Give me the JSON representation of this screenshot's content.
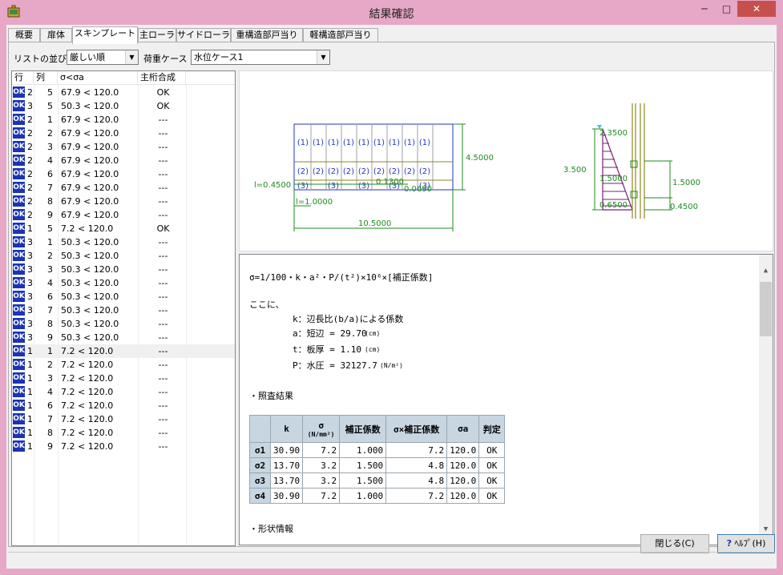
{
  "window": {
    "title": "結果確認",
    "min_glyph": "─",
    "max_glyph": "□",
    "close_glyph": "✕"
  },
  "tabs": [
    "概要",
    "扉体",
    "スキンプレート",
    "主ローラ",
    "サイドローラ",
    "重構造部戸当り",
    "軽構造部戸当り"
  ],
  "active_tab": 2,
  "filters": {
    "sort_label": "リストの並び",
    "sort_value": "厳しい順",
    "case_label": "荷重ケース",
    "case_value": "水位ケース1"
  },
  "list": {
    "headers": [
      "行",
      "列",
      "σ<σa",
      "主桁合成"
    ],
    "ok_badge": "OK",
    "rows": [
      [
        "2",
        "5",
        "67.9 < 120.0",
        "OK"
      ],
      [
        "3",
        "5",
        "50.3 < 120.0",
        "OK"
      ],
      [
        "2",
        "1",
        "67.9 < 120.0",
        "---"
      ],
      [
        "2",
        "2",
        "67.9 < 120.0",
        "---"
      ],
      [
        "2",
        "3",
        "67.9 < 120.0",
        "---"
      ],
      [
        "2",
        "4",
        "67.9 < 120.0",
        "---"
      ],
      [
        "2",
        "6",
        "67.9 < 120.0",
        "---"
      ],
      [
        "2",
        "7",
        "67.9 < 120.0",
        "---"
      ],
      [
        "2",
        "8",
        "67.9 < 120.0",
        "---"
      ],
      [
        "2",
        "9",
        "67.9 < 120.0",
        "---"
      ],
      [
        "1",
        "5",
        "7.2 < 120.0",
        "OK"
      ],
      [
        "3",
        "1",
        "50.3 < 120.0",
        "---"
      ],
      [
        "3",
        "2",
        "50.3 < 120.0",
        "---"
      ],
      [
        "3",
        "3",
        "50.3 < 120.0",
        "---"
      ],
      [
        "3",
        "4",
        "50.3 < 120.0",
        "---"
      ],
      [
        "3",
        "6",
        "50.3 < 120.0",
        "---"
      ],
      [
        "3",
        "7",
        "50.3 < 120.0",
        "---"
      ],
      [
        "3",
        "8",
        "50.3 < 120.0",
        "---"
      ],
      [
        "3",
        "9",
        "50.3 < 120.0",
        "---"
      ],
      [
        "1",
        "1",
        "7.2 < 120.0",
        "---"
      ],
      [
        "1",
        "2",
        "7.2 < 120.0",
        "---"
      ],
      [
        "1",
        "3",
        "7.2 < 120.0",
        "---"
      ],
      [
        "1",
        "4",
        "7.2 < 120.0",
        "---"
      ],
      [
        "1",
        "6",
        "7.2 < 120.0",
        "---"
      ],
      [
        "1",
        "7",
        "7.2 < 120.0",
        "---"
      ],
      [
        "1",
        "8",
        "7.2 < 120.0",
        "---"
      ],
      [
        "1",
        "9",
        "7.2 < 120.0",
        "---"
      ]
    ],
    "selected_index": 19
  },
  "diagram": {
    "panel_labels_1": "(1)",
    "panel_labels_2": "(2)",
    "panel_labels_3": "(3)",
    "dim_height": "4.5000",
    "dim_width": "10.5000",
    "dim_l045": "l=0.4500",
    "dim_l10": "l=1.0000",
    "dim_1300": "0.1300",
    "dim_0690": "0.0690",
    "side_2350": "2.3500",
    "side_3500": "3.500",
    "side_1500a": "1.5000",
    "side_1500b": "1.5000",
    "side_0650": "0.6500",
    "side_0450": "0.4500"
  },
  "report": {
    "formula": "σ=1/100・k・a²・P/(t²)×10⁶×[補正係数]",
    "where": "ここに、",
    "k_def": "k：辺長比(b/a)による係数",
    "a_def": "a：短辺 = 29.70",
    "a_unit": "(cm)",
    "t_def": "t：板厚 = 1.10",
    "t_unit": "(cm)",
    "p_def": "P：水圧 = 32127.7",
    "p_unit": "(N/m²)",
    "check_title": "・照査結果",
    "next_title": "・形状情報",
    "table_headers": [
      "",
      "k",
      "σ",
      "補正係数",
      "σ×補正係数",
      "σa",
      "判定"
    ],
    "sigma_unit": "(N/mm²)",
    "table_rows": [
      [
        "σ1",
        "30.90",
        "7.2",
        "1.000",
        "7.2",
        "120.0",
        "OK"
      ],
      [
        "σ2",
        "13.70",
        "3.2",
        "1.500",
        "4.8",
        "120.0",
        "OK"
      ],
      [
        "σ3",
        "13.70",
        "3.2",
        "1.500",
        "4.8",
        "120.0",
        "OK"
      ],
      [
        "σ4",
        "30.90",
        "7.2",
        "1.000",
        "7.2",
        "120.0",
        "OK"
      ]
    ]
  },
  "buttons": {
    "close": "閉じる(C)",
    "help": "ﾍﾙﾌﾟ(H)"
  },
  "colors": {
    "badge": "#1b33b5",
    "dim_green": "#1e8c1e",
    "panel_blue": "#2233cc",
    "load_purple": "#7a1f7a",
    "title_pink": "#e7a7c6"
  }
}
